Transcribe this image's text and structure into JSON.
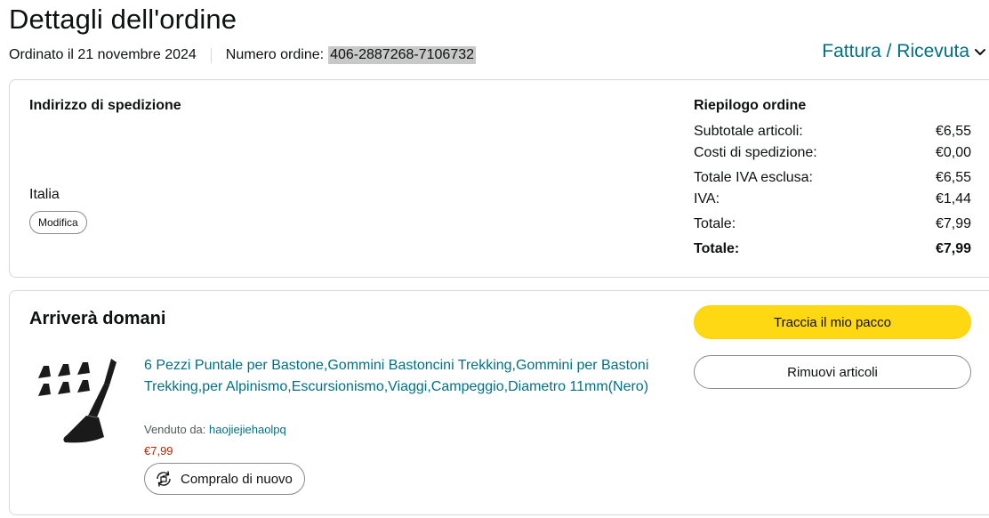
{
  "page": {
    "title": "Dettagli dell'ordine"
  },
  "meta": {
    "ordered_label": "Ordinato il 21 novembre 2024",
    "order_number_label": "Numero ordine:",
    "order_number": "406-2887268-7106732"
  },
  "invoice": {
    "label": "Fattura / Ricevuta",
    "icon": "chevron-down-icon"
  },
  "address": {
    "heading": "Indirizzo di spedizione",
    "country": "Italia",
    "edit_label": "Modifica"
  },
  "summary": {
    "heading": "Riepilogo ordine",
    "rows": [
      {
        "label": "Subtotale articoli:",
        "value": "€6,55"
      },
      {
        "label": "Costi di spedizione:",
        "value": "€0,00"
      },
      {
        "label": "Totale IVA esclusa:",
        "value": "€6,55"
      },
      {
        "label": "IVA:",
        "value": "€1,44"
      },
      {
        "label": "Totale:",
        "value": "€7,99"
      },
      {
        "label": "Totale:",
        "value": "€7,99"
      }
    ]
  },
  "shipment": {
    "heading": "Arriverà domani",
    "track_label": "Traccia il mio pacco",
    "remove_label": "Rimuovi articoli",
    "product": {
      "title": "6 Pezzi Puntale per Bastone,Gommini Bastoncini Trekking,Gommini per Bastoni Trekking,per Alpinismo,Escursionismo,Viaggi,Campeggio,Diametro 11mm(Nero)",
      "sold_by_label": "Venduto da:",
      "seller": "haojiejiehaolpq",
      "price": "€7,99",
      "buy_again_label": "Compralo di nuovo",
      "buy_again_icon": "buy-again-icon"
    }
  },
  "colors": {
    "link": "#007185",
    "price": "#b12704",
    "primary_button": "#ffd814",
    "border": "#d5d9d9"
  }
}
